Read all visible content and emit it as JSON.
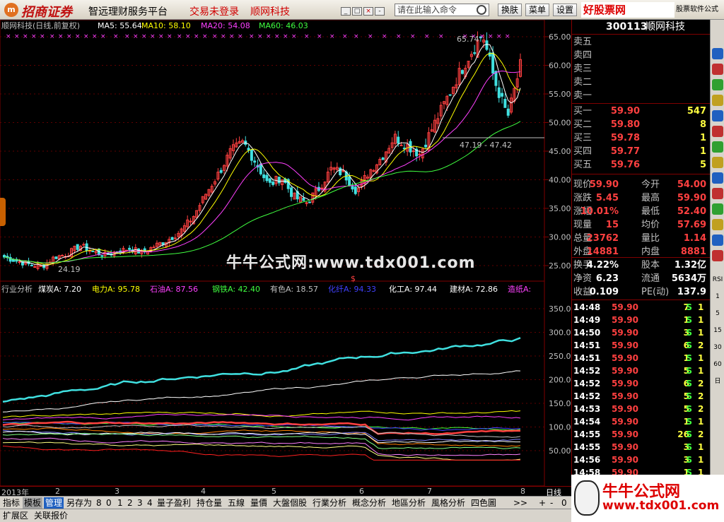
{
  "topbar": {
    "logo_glyph": "m",
    "logo_text": "招商证券",
    "platform": "智远理财服务平台",
    "login_status": "交易未登录",
    "stock_name": "顺网科技",
    "command_placeholder": "请在此输入命令",
    "buttons": [
      "换肤",
      "菜单",
      "设置"
    ],
    "brand": "好股票网Goodgupiao.com",
    "brand_sub": "股票软件公式",
    "window_controls": [
      "_",
      "□",
      "×",
      "-",
      "□",
      "×"
    ]
  },
  "chart_header": {
    "title": "顺网科技(日线,前复权)",
    "ma5": "MA5: 55.64",
    "ma10": "MA10: 58.10",
    "ma20": "MA20: 54.08",
    "ma60": "MA60: 46.03",
    "ma_colors": {
      "ma5": "#ffffff",
      "ma10": "#ffff00",
      "ma20": "#ff40ff",
      "ma60": "#40ff40"
    }
  },
  "price_annotations": {
    "high": "65.74",
    "low": "24.19",
    "range": "47.19 - 47.42",
    "marker": "$"
  },
  "price_axis": [
    "65.00",
    "60.00",
    "55.00",
    "50.00",
    "45.00",
    "40.00",
    "35.00",
    "30.00",
    "25.00"
  ],
  "indicator_header": {
    "name": "行业分析",
    "items": [
      {
        "label": "煤炭A: 7.20",
        "color": "#ffffff"
      },
      {
        "label": "电力A: 95.78",
        "color": "#ffff00"
      },
      {
        "label": "石油A: 87.56",
        "color": "#ff40ff"
      },
      {
        "label": "钢铁A: 42.40",
        "color": "#40ff40"
      },
      {
        "label": "有色A: 18.57",
        "color": "#c0c0c0"
      },
      {
        "label": "化纤A: 94.33",
        "color": "#4040ff"
      },
      {
        "label": "化工A: 97.44",
        "color": "#ffffff"
      },
      {
        "label": "建材A: 72.86",
        "color": "#ffffff"
      },
      {
        "label": "造纸A:",
        "color": "#ff40ff"
      }
    ]
  },
  "indicator_axis": [
    "350.0",
    "300.0",
    "250.0",
    "200.0",
    "150.0",
    "100.0",
    "50.00"
  ],
  "watermark": "牛牛公式网:www.tdx001.com",
  "xaxis": {
    "year": "2013年",
    "months": [
      "2",
      "3",
      "4",
      "5",
      "6",
      "7",
      "8"
    ],
    "period": "日线"
  },
  "right_panel": {
    "code": "300113",
    "name": "顺网科技",
    "sell_labels": [
      "卖五",
      "卖四",
      "卖三",
      "卖二",
      "卖一"
    ],
    "buy": [
      {
        "label": "买一",
        "price": "59.90",
        "vol": "547"
      },
      {
        "label": "买二",
        "price": "59.80",
        "vol": "8"
      },
      {
        "label": "买三",
        "price": "59.78",
        "vol": "1"
      },
      {
        "label": "买四",
        "price": "59.77",
        "vol": "1"
      },
      {
        "label": "买五",
        "price": "59.76",
        "vol": "5"
      }
    ],
    "quotes": [
      {
        "l1": "现价",
        "v1": "59.90",
        "l2": "今开",
        "v2": "54.00"
      },
      {
        "l1": "涨跌",
        "v1": "5.45",
        "l2": "最高",
        "v2": "59.90"
      },
      {
        "l1": "涨幅",
        "v1": "10.01%",
        "l2": "最低",
        "v2": "52.40"
      },
      {
        "l1": "现量",
        "v1": "15",
        "l2": "均价",
        "v2": "57.69"
      },
      {
        "l1": "总量",
        "v1": "23762",
        "l2": "量比",
        "v2": "1.14"
      },
      {
        "l1": "外盘",
        "v1": "14881",
        "l2": "内盘",
        "v2": "8881"
      }
    ],
    "stats": [
      {
        "l1": "换手",
        "v1": "4.22%",
        "l2": "股本",
        "v2": "1.32亿"
      },
      {
        "l1": "净资",
        "v1": "6.23",
        "l2": "流通",
        "v2": "5634万"
      },
      {
        "l1": "收益",
        "v1": "0.109",
        "l2": "PE(动)",
        "v2": "137.9"
      }
    ],
    "trades": [
      {
        "t": "14:48",
        "p": "59.90",
        "v": "7",
        "s": "S",
        "n": "1"
      },
      {
        "t": "14:49",
        "p": "59.90",
        "v": "1",
        "s": "S",
        "n": "1"
      },
      {
        "t": "14:50",
        "p": "59.90",
        "v": "3",
        "s": "S",
        "n": "1"
      },
      {
        "t": "14:51",
        "p": "59.90",
        "v": "6",
        "s": "S",
        "n": "2"
      },
      {
        "t": "14:51",
        "p": "59.90",
        "v": "1",
        "s": "S",
        "n": "1"
      },
      {
        "t": "14:52",
        "p": "59.90",
        "v": "5",
        "s": "S",
        "n": "1"
      },
      {
        "t": "14:52",
        "p": "59.90",
        "v": "6",
        "s": "S",
        "n": "2"
      },
      {
        "t": "14:52",
        "p": "59.90",
        "v": "5",
        "s": "S",
        "n": "2"
      },
      {
        "t": "14:53",
        "p": "59.90",
        "v": "5",
        "s": "S",
        "n": "2"
      },
      {
        "t": "14:54",
        "p": "59.90",
        "v": "1",
        "s": "S",
        "n": "1"
      },
      {
        "t": "14:55",
        "p": "59.90",
        "v": "26",
        "s": "S",
        "n": "2"
      },
      {
        "t": "14:55",
        "p": "59.90",
        "v": "3",
        "s": "S",
        "n": "1"
      },
      {
        "t": "14:56",
        "p": "59.90",
        "v": "3",
        "s": "S",
        "n": "1"
      },
      {
        "t": "14:58",
        "p": "59.90",
        "v": "1",
        "s": "S",
        "n": "1"
      }
    ]
  },
  "right_toolbar": [
    "RSI",
    "1",
    "5",
    "15",
    "30",
    "60",
    "日"
  ],
  "tabs": [
    "指标",
    "模板",
    "管理",
    "另存为",
    "8",
    "0",
    "1",
    "2",
    "3",
    "4",
    "量子盈利",
    "持仓量",
    "五線",
    "量價",
    "大盤個股",
    "行業分析",
    "概念分析",
    "地區分析",
    "風格分析",
    "四色圖",
    ">>",
    "+",
    "-",
    "0"
  ],
  "statusbar": [
    "扩展区",
    "关联报价"
  ],
  "bottom_brand": {
    "line1": "牛牛公式网",
    "line2": "www.tdx001.com"
  },
  "chart_data": {
    "type": "candlestick",
    "title": "顺网科技(日线,前复权)",
    "ylim": [
      23,
      67
    ],
    "x_months": [
      "2013-01",
      "2013-02",
      "2013-03",
      "2013-04",
      "2013-05",
      "2013-06",
      "2013-07",
      "2013-08"
    ],
    "close_path": [
      26.5,
      25.8,
      25.2,
      24.8,
      26.5,
      27.0,
      28.5,
      27.5,
      26.8,
      27.5,
      28.0,
      27.2,
      28.5,
      29.5,
      31.0,
      33.5,
      37.5,
      41.0,
      45.0,
      46.5,
      43.0,
      39.0,
      40.5,
      37.0,
      36.0,
      38.5,
      42.0,
      41.0,
      38.0,
      41.5,
      44.0,
      47.5,
      46.0,
      44.5,
      49.0,
      53.5,
      58.0,
      62.0,
      65.5,
      57.0,
      51.0,
      59.9
    ],
    "ma60_path": [
      25.5,
      25.6,
      25.7,
      26.0,
      26.4,
      27.0,
      27.8,
      28.8,
      30.0,
      31.5,
      33.0,
      34.5,
      36.0,
      37.5,
      39.0,
      40.5,
      42.0,
      43.5,
      45.0,
      46.0
    ]
  }
}
